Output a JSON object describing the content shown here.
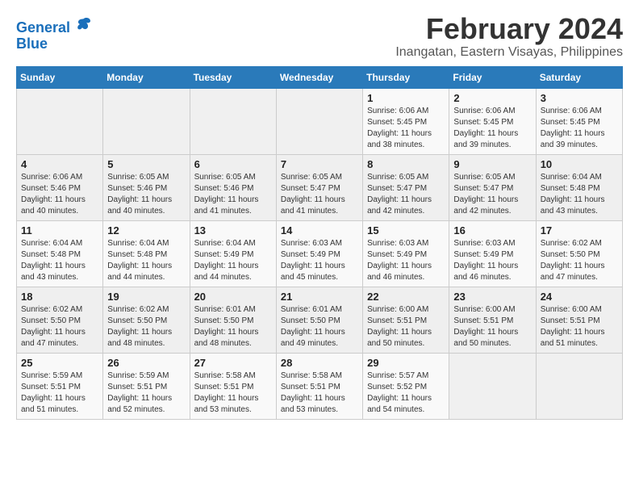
{
  "logo": {
    "line1": "General",
    "line2": "Blue"
  },
  "title": "February 2024",
  "location": "Inangatan, Eastern Visayas, Philippines",
  "headers": [
    "Sunday",
    "Monday",
    "Tuesday",
    "Wednesday",
    "Thursday",
    "Friday",
    "Saturday"
  ],
  "weeks": [
    [
      {
        "day": "",
        "info": ""
      },
      {
        "day": "",
        "info": ""
      },
      {
        "day": "",
        "info": ""
      },
      {
        "day": "",
        "info": ""
      },
      {
        "day": "1",
        "info": "Sunrise: 6:06 AM\nSunset: 5:45 PM\nDaylight: 11 hours\nand 38 minutes."
      },
      {
        "day": "2",
        "info": "Sunrise: 6:06 AM\nSunset: 5:45 PM\nDaylight: 11 hours\nand 39 minutes."
      },
      {
        "day": "3",
        "info": "Sunrise: 6:06 AM\nSunset: 5:45 PM\nDaylight: 11 hours\nand 39 minutes."
      }
    ],
    [
      {
        "day": "4",
        "info": "Sunrise: 6:06 AM\nSunset: 5:46 PM\nDaylight: 11 hours\nand 40 minutes."
      },
      {
        "day": "5",
        "info": "Sunrise: 6:05 AM\nSunset: 5:46 PM\nDaylight: 11 hours\nand 40 minutes."
      },
      {
        "day": "6",
        "info": "Sunrise: 6:05 AM\nSunset: 5:46 PM\nDaylight: 11 hours\nand 41 minutes."
      },
      {
        "day": "7",
        "info": "Sunrise: 6:05 AM\nSunset: 5:47 PM\nDaylight: 11 hours\nand 41 minutes."
      },
      {
        "day": "8",
        "info": "Sunrise: 6:05 AM\nSunset: 5:47 PM\nDaylight: 11 hours\nand 42 minutes."
      },
      {
        "day": "9",
        "info": "Sunrise: 6:05 AM\nSunset: 5:47 PM\nDaylight: 11 hours\nand 42 minutes."
      },
      {
        "day": "10",
        "info": "Sunrise: 6:04 AM\nSunset: 5:48 PM\nDaylight: 11 hours\nand 43 minutes."
      }
    ],
    [
      {
        "day": "11",
        "info": "Sunrise: 6:04 AM\nSunset: 5:48 PM\nDaylight: 11 hours\nand 43 minutes."
      },
      {
        "day": "12",
        "info": "Sunrise: 6:04 AM\nSunset: 5:48 PM\nDaylight: 11 hours\nand 44 minutes."
      },
      {
        "day": "13",
        "info": "Sunrise: 6:04 AM\nSunset: 5:49 PM\nDaylight: 11 hours\nand 44 minutes."
      },
      {
        "day": "14",
        "info": "Sunrise: 6:03 AM\nSunset: 5:49 PM\nDaylight: 11 hours\nand 45 minutes."
      },
      {
        "day": "15",
        "info": "Sunrise: 6:03 AM\nSunset: 5:49 PM\nDaylight: 11 hours\nand 46 minutes."
      },
      {
        "day": "16",
        "info": "Sunrise: 6:03 AM\nSunset: 5:49 PM\nDaylight: 11 hours\nand 46 minutes."
      },
      {
        "day": "17",
        "info": "Sunrise: 6:02 AM\nSunset: 5:50 PM\nDaylight: 11 hours\nand 47 minutes."
      }
    ],
    [
      {
        "day": "18",
        "info": "Sunrise: 6:02 AM\nSunset: 5:50 PM\nDaylight: 11 hours\nand 47 minutes."
      },
      {
        "day": "19",
        "info": "Sunrise: 6:02 AM\nSunset: 5:50 PM\nDaylight: 11 hours\nand 48 minutes."
      },
      {
        "day": "20",
        "info": "Sunrise: 6:01 AM\nSunset: 5:50 PM\nDaylight: 11 hours\nand 48 minutes."
      },
      {
        "day": "21",
        "info": "Sunrise: 6:01 AM\nSunset: 5:50 PM\nDaylight: 11 hours\nand 49 minutes."
      },
      {
        "day": "22",
        "info": "Sunrise: 6:00 AM\nSunset: 5:51 PM\nDaylight: 11 hours\nand 50 minutes."
      },
      {
        "day": "23",
        "info": "Sunrise: 6:00 AM\nSunset: 5:51 PM\nDaylight: 11 hours\nand 50 minutes."
      },
      {
        "day": "24",
        "info": "Sunrise: 6:00 AM\nSunset: 5:51 PM\nDaylight: 11 hours\nand 51 minutes."
      }
    ],
    [
      {
        "day": "25",
        "info": "Sunrise: 5:59 AM\nSunset: 5:51 PM\nDaylight: 11 hours\nand 51 minutes."
      },
      {
        "day": "26",
        "info": "Sunrise: 5:59 AM\nSunset: 5:51 PM\nDaylight: 11 hours\nand 52 minutes."
      },
      {
        "day": "27",
        "info": "Sunrise: 5:58 AM\nSunset: 5:51 PM\nDaylight: 11 hours\nand 53 minutes."
      },
      {
        "day": "28",
        "info": "Sunrise: 5:58 AM\nSunset: 5:51 PM\nDaylight: 11 hours\nand 53 minutes."
      },
      {
        "day": "29",
        "info": "Sunrise: 5:57 AM\nSunset: 5:52 PM\nDaylight: 11 hours\nand 54 minutes."
      },
      {
        "day": "",
        "info": ""
      },
      {
        "day": "",
        "info": ""
      }
    ]
  ]
}
